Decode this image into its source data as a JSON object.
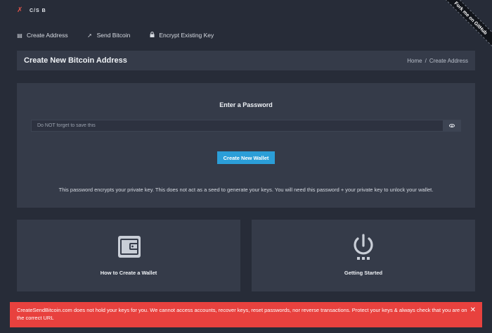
{
  "brand": {
    "logo_text": "C/S B",
    "logo_icon": "bitcoin-tag-icon"
  },
  "ribbon": {
    "label": "Fork me on GitHub"
  },
  "nav": {
    "items": [
      {
        "label": "Create Address",
        "icon": "wallet-icon"
      },
      {
        "label": "Send Bitcoin",
        "icon": "send-icon"
      },
      {
        "label": "Encrypt Existing Key",
        "icon": "lock-icon"
      }
    ]
  },
  "header": {
    "title": "Create New Bitcoin Address",
    "breadcrumb": {
      "home": "Home",
      "separator": "/",
      "current": "Create Address"
    }
  },
  "password_card": {
    "title": "Enter a Password",
    "input_placeholder": "Do NOT forget to save this",
    "input_value": "",
    "toggle_icon": "eye-icon",
    "button_label": "Create New Wallet",
    "description": "This password encrypts your private key. This does not act as a seed to generate your keys. You will need this password + your private key to unlock your wallet."
  },
  "tiles": [
    {
      "label": "How to Create a Wallet",
      "icon": "wallet-icon"
    },
    {
      "label": "Getting Started",
      "icon": "power-icon"
    }
  ],
  "alert": {
    "text": "CreateSendBitcoin.com does not hold your keys for you. We cannot access accounts, recover keys, reset passwords, nor reverse transactions. Protect your keys & always check that you are on the correct URL",
    "close_icon": "close-icon"
  },
  "colors": {
    "background": "#272c38",
    "panel": "#353b49",
    "accent_button": "#2b9ed8",
    "alert": "#e8413e"
  }
}
